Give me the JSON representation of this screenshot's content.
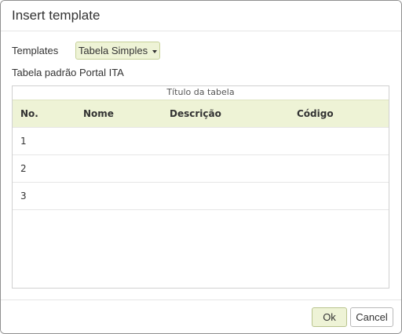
{
  "dialog": {
    "title": "Insert template"
  },
  "templates": {
    "label": "Templates",
    "selected": "Tabela Simples",
    "description": "Tabela padrão Portal ITA"
  },
  "preview": {
    "caption": "Título da tabela",
    "headers": [
      "No.",
      "Nome",
      "Descrição",
      "Código"
    ],
    "rows": [
      [
        "1",
        "",
        "",
        ""
      ],
      [
        "2",
        "",
        "",
        ""
      ],
      [
        "3",
        "",
        "",
        ""
      ]
    ]
  },
  "footer": {
    "ok_label": "Ok",
    "cancel_label": "Cancel"
  },
  "colors": {
    "accent_bg": "#eef3d6",
    "border": "#d0d0d0"
  },
  "icons": {
    "dropdown_caret": "caret-down-icon"
  }
}
